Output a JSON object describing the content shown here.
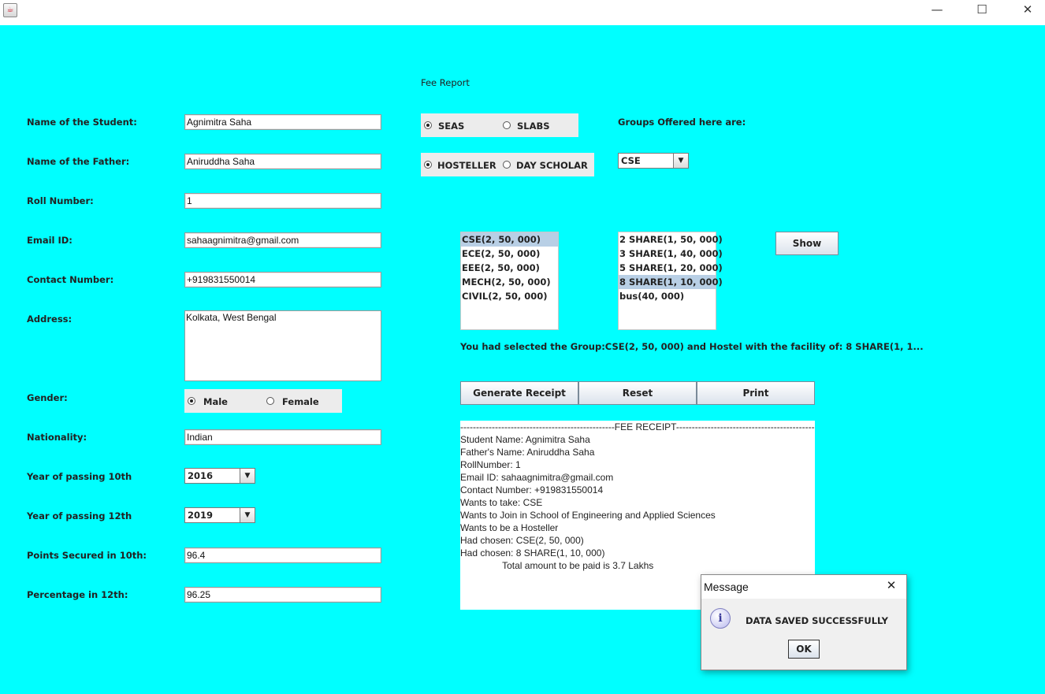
{
  "window": {
    "minimize_glyph": "—",
    "maximize_glyph": "☐",
    "close_glyph": "✕"
  },
  "header": {
    "title": "Fee Report"
  },
  "form": {
    "student_name": {
      "label": "Name of the Student:",
      "value": "Agnimitra Saha"
    },
    "father_name": {
      "label": "Name of the Father:",
      "value": "Aniruddha Saha"
    },
    "roll_number": {
      "label": "Roll Number:",
      "value": "1"
    },
    "email": {
      "label": "Email ID:",
      "value": "sahaagnimitra@gmail.com"
    },
    "contact": {
      "label": "Contact Number:",
      "value": "+919831550014"
    },
    "address": {
      "label": "Address:",
      "value": "Kolkata, West Bengal"
    },
    "gender": {
      "label": "Gender:",
      "options": [
        "Male",
        "Female"
      ],
      "selected": "Male"
    },
    "nationality": {
      "label": "Nationality:",
      "value": "Indian"
    },
    "year10": {
      "label": "Year of passing 10th",
      "value": "2016"
    },
    "year12": {
      "label": "Year of passing 12th",
      "value": "2019"
    },
    "points10": {
      "label": "Points Secured in 10th:",
      "value": "96.4"
    },
    "percent12": {
      "label": "Percentage in 12th:",
      "value": "96.25"
    }
  },
  "school": {
    "options": [
      "SEAS",
      "SLABS"
    ],
    "selected": "SEAS"
  },
  "residence": {
    "options": [
      "HOSTELLER",
      "DAY SCHOLAR"
    ],
    "selected": "HOSTELLER"
  },
  "groups": {
    "label": "Groups Offered here are:",
    "value": "CSE"
  },
  "group_list": {
    "items": [
      "CSE(2, 50, 000)",
      "ECE(2, 50, 000)",
      "EEE(2, 50, 000)",
      "MECH(2, 50, 000)",
      "CIVIL(2, 50, 000)"
    ],
    "selected_index": 0
  },
  "hostel_list": {
    "items": [
      "2 SHARE(1, 50, 000)",
      "3 SHARE(1, 40, 000)",
      "5 SHARE(1, 20, 000)",
      "8 SHARE(1, 10, 000)",
      "bus(40, 000)"
    ],
    "selected_index": 3
  },
  "show_button": "Show",
  "selection_text": "You had selected the Group:CSE(2, 50, 000) and Hostel with the facility of: 8 SHARE(1, 1...",
  "actions": {
    "generate": "Generate Receipt",
    "reset": "Reset",
    "print": "Print"
  },
  "receipt": {
    "lines": [
      "-------------------------------------------------FEE RECEIPT-------------------------------------------------------",
      "Student Name: Agnimitra Saha",
      "Father's Name: Aniruddha Saha",
      "RollNumber: 1",
      "Email ID: sahaagnimitra@gmail.com",
      "Contact Number: +919831550014",
      "Wants to take: CSE",
      "Wants to Join in School of Engineering and Applied Sciences",
      "Wants to be a Hosteller",
      "Had chosen: CSE(2, 50, 000)",
      "Had chosen: 8 SHARE(1, 10, 000)",
      "                Total amount to be paid is 3.7 Lakhs"
    ]
  },
  "dialog": {
    "title": "Message",
    "close_glyph": "✕",
    "icon_glyph": "i",
    "message": "DATA SAVED SUCCESSFULLY",
    "ok": "OK"
  }
}
